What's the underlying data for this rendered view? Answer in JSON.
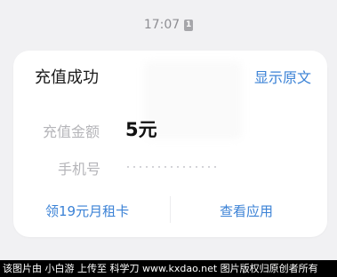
{
  "status": {
    "time": "17:07",
    "sim_badge": "1"
  },
  "card": {
    "title": "充值成功",
    "show_original": "显示原文",
    "amount_label": "充值金额",
    "amount_value": "5元",
    "phone_label": "手机号",
    "action_left": "领19元月租卡",
    "action_right": "查看应用"
  },
  "watermark": {
    "text": "该图片由 小白游 上传至 科学刀 www.kxdao.net 图片版权归原创者所有"
  }
}
